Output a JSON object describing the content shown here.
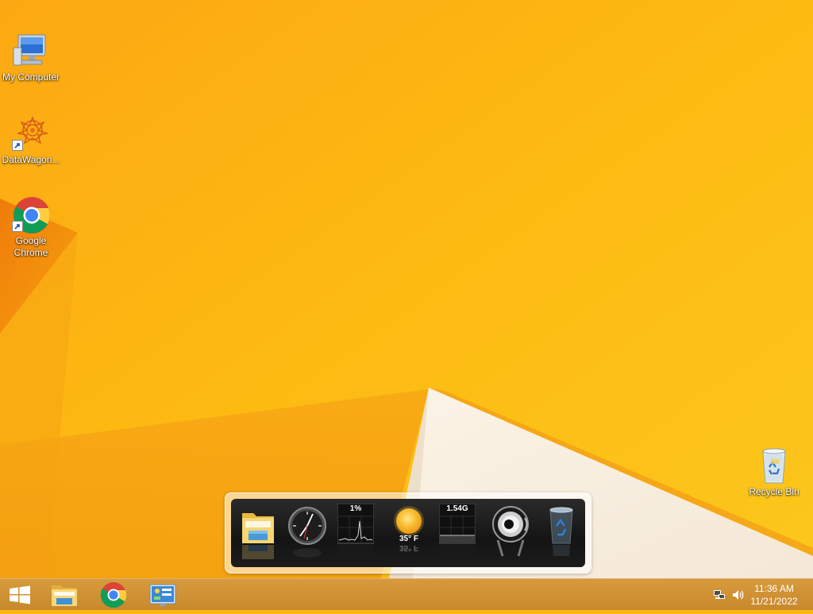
{
  "desktop": {
    "icons": [
      {
        "label": "My Computer",
        "icon": "computer-icon"
      },
      {
        "label": "DataWagon...",
        "icon": "datawagon-icon"
      },
      {
        "label": "Google Chrome",
        "icon": "chrome-icon"
      },
      {
        "label": "Recycle Bin",
        "icon": "recycle-bin-icon"
      }
    ]
  },
  "dock": {
    "items": [
      {
        "name": "File Explorer",
        "icon": "folder-icon"
      },
      {
        "name": "Clock",
        "icon": "clock-icon"
      },
      {
        "name": "CPU Monitor",
        "icon": "cpu-graph-icon",
        "value": "1%"
      },
      {
        "name": "Weather",
        "icon": "sun-icon",
        "value": "35° F"
      },
      {
        "name": "Memory Monitor",
        "icon": "memory-graph-icon",
        "value": "1.54G"
      },
      {
        "name": "Speaker",
        "icon": "speaker-icon"
      },
      {
        "name": "Recycle Bin",
        "icon": "trash-icon"
      }
    ]
  },
  "taskbar": {
    "buttons": [
      {
        "name": "Start",
        "icon": "windows-logo-icon"
      },
      {
        "name": "File Explorer",
        "icon": "file-explorer-icon"
      },
      {
        "name": "Google Chrome",
        "icon": "chrome-icon"
      },
      {
        "name": "Control Panel",
        "icon": "control-panel-icon"
      }
    ],
    "tray": {
      "network_icon": "network-icon",
      "volume_icon": "volume-icon",
      "time": "11:36 AM",
      "date": "11/21/2022"
    }
  },
  "colors": {
    "wallpaper_main": "#fdb612",
    "wallpaper_dark": "#f08a0c",
    "wallpaper_light": "#f7efe2",
    "taskbar": "#cf9033"
  }
}
